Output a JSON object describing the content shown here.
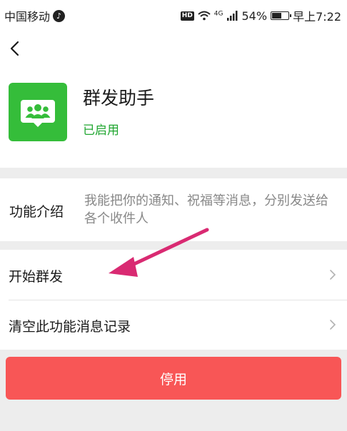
{
  "status_bar": {
    "carrier": "中国移动",
    "network": "4G",
    "battery": "54%",
    "time": "早上7:22"
  },
  "header": {
    "app_name": "群发助手",
    "app_status": "已启用",
    "icon_color": "#35bd3a",
    "status_color": "#20a630"
  },
  "intro": {
    "label": "功能介绍",
    "text": "我能把你的通知、祝福等消息，分别发送给各个收件人"
  },
  "menu": {
    "items": [
      {
        "label": "开始群发"
      },
      {
        "label": "清空此功能消息记录"
      }
    ]
  },
  "actions": {
    "disable_label": "停用",
    "disable_color": "#f85656"
  },
  "annotation": {
    "arrow_color": "#d92a72"
  }
}
